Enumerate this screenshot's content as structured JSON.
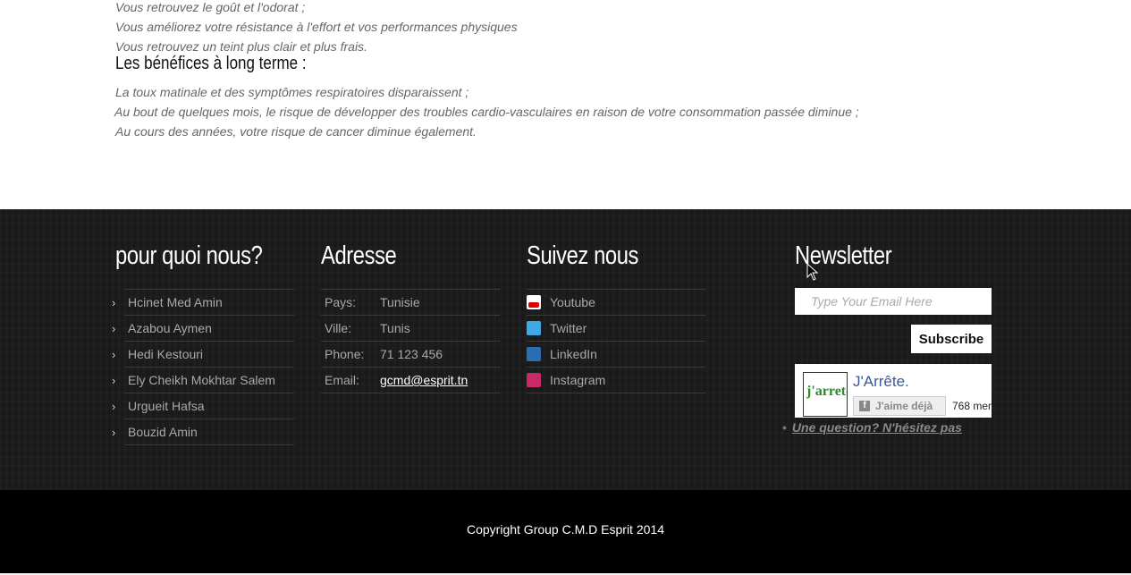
{
  "content": {
    "short_term_lines": [
      "Vous retrouvez le goût et l'odorat ;",
      "Vous améliorez votre résistance à l'effort et vos performances physiques",
      "Vous retrouvez un teint plus clair et plus frais."
    ],
    "long_term_heading": "Les bénéfices à long terme :",
    "long_term_lines": [
      "La toux matinale et des symptômes respiratoires disparaissent ;",
      "Au bout de quelques mois, le risque de développer des troubles cardio-vasculaires en raison de votre consommation passée diminue ;",
      "Au cours des années, votre risque de cancer diminue également."
    ]
  },
  "footer": {
    "why": {
      "title": "pour quoi nous?",
      "items": [
        "Hcinet Med Amin",
        "Azabou Aymen",
        "Hedi Kestouri",
        "Ely Cheikh Mokhtar Salem",
        "Urgueit Hafsa",
        "Bouzid Amin"
      ]
    },
    "address": {
      "title": "Adresse",
      "rows": [
        {
          "label": "Pays:",
          "value": "Tunisie"
        },
        {
          "label": "Ville:",
          "value": "Tunis"
        },
        {
          "label": "Phone:",
          "value": "71 123 456"
        },
        {
          "label": "Email:",
          "value": "gcmd@esprit.tn"
        }
      ]
    },
    "social": {
      "title": "Suivez nous",
      "items": [
        {
          "label": "Youtube",
          "icon": "youtube-icon"
        },
        {
          "label": "Twitter",
          "icon": "twitter-icon"
        },
        {
          "label": "LinkedIn",
          "icon": "linkedin-icon"
        },
        {
          "label": "Instagram",
          "icon": "instagram-icon"
        }
      ]
    },
    "newsletter": {
      "title": "Newsletter",
      "email_placeholder": "Type Your Email Here",
      "subscribe_label": "Subscribe",
      "fb_page_name": "J'Arrête.",
      "fb_like_label": "J'aime déjà",
      "fb_count": "768 mem",
      "fb_logo_text": "j'arrete",
      "question_link": "Une question? N'hésitez pas"
    },
    "copyright": "Copyright Group C.M.D Esprit 2014"
  }
}
